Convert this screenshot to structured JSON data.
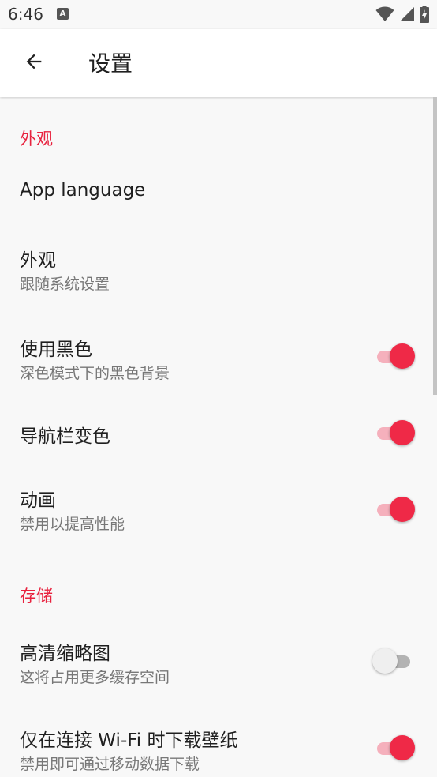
{
  "status_bar": {
    "time": "6:46",
    "notification_icon": "a-badge-icon",
    "icons": [
      "wifi-icon",
      "cell-signal-icon",
      "battery-charging-icon"
    ]
  },
  "app_bar": {
    "back_icon": "arrow-back-icon",
    "title": "设置"
  },
  "sections": {
    "appearance": {
      "header": "外观",
      "items": {
        "app_language": {
          "title": "App language"
        },
        "theme": {
          "title": "外观",
          "subtitle": "跟随系统设置"
        },
        "black_theme": {
          "title": "使用黑色",
          "subtitle": "深色模式下的黑色背景",
          "enabled": true
        },
        "nav_color": {
          "title": "导航栏变色",
          "enabled": true
        },
        "animation": {
          "title": "动画",
          "subtitle": "禁用以提高性能",
          "enabled": true
        }
      }
    },
    "storage": {
      "header": "存储",
      "items": {
        "hd_thumbnails": {
          "title": "高清缩略图",
          "subtitle": "这将占用更多缓存空间",
          "enabled": false
        },
        "wifi_only": {
          "title": "仅在连接 Wi-Fi 时下载壁纸",
          "subtitle": "禁用即可通过移动数据下载",
          "enabled": true
        }
      }
    }
  },
  "colors": {
    "accent": "#ef2947",
    "accent_track": "#f5b0bc",
    "section_header": "#e8233f",
    "background": "#f8f8f8",
    "app_bar": "#ffffff"
  }
}
